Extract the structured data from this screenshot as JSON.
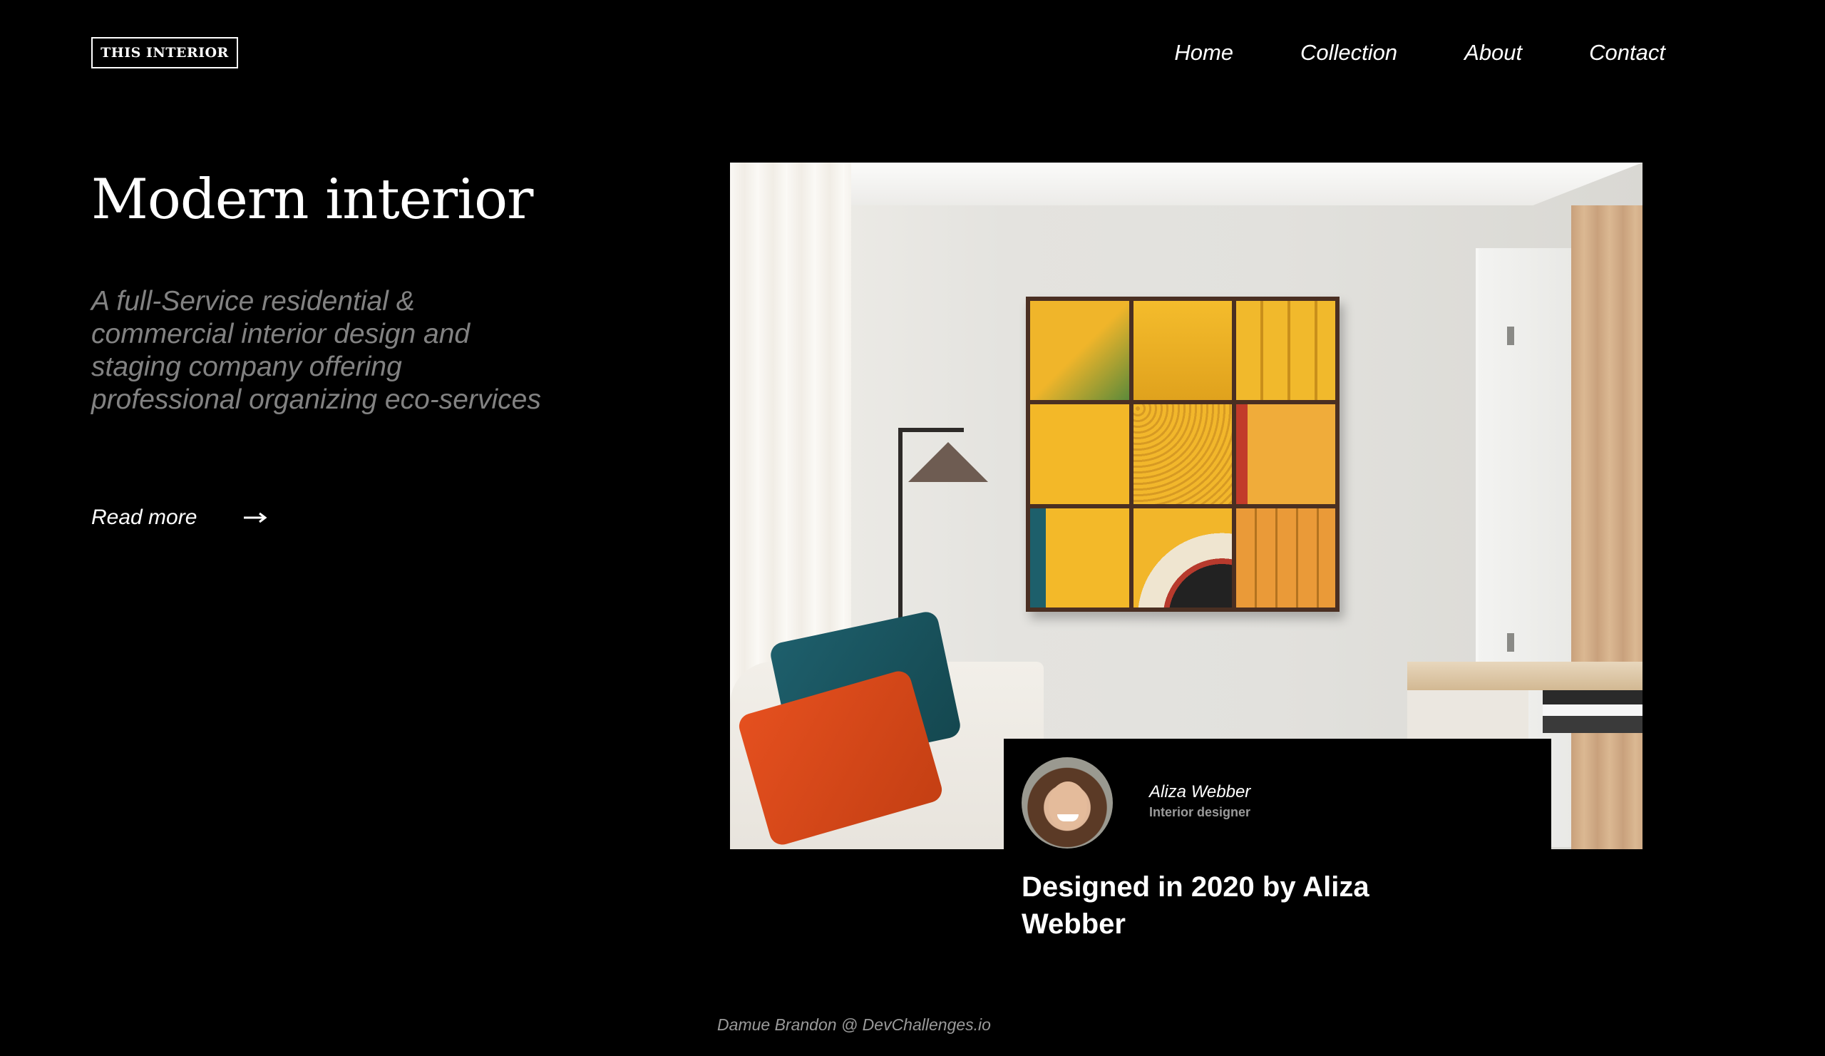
{
  "header": {
    "logo": "THIS INTERIOR",
    "nav": [
      {
        "label": "Home"
      },
      {
        "label": "Collection"
      },
      {
        "label": "About"
      },
      {
        "label": "Contact"
      }
    ]
  },
  "hero": {
    "title": "Modern interior",
    "description": "A full-Service residential & commercial interior design and staging company offering professional organizing eco-services",
    "read_more": "Read more",
    "read_more_icon": "arrow-right-icon"
  },
  "designer": {
    "name": "Aliza Webber",
    "role": "Interior designer",
    "caption": "Designed in 2020 by Aliza Webber"
  },
  "footer": {
    "credit": "Damue Brandon @ DevChallenges.io"
  }
}
